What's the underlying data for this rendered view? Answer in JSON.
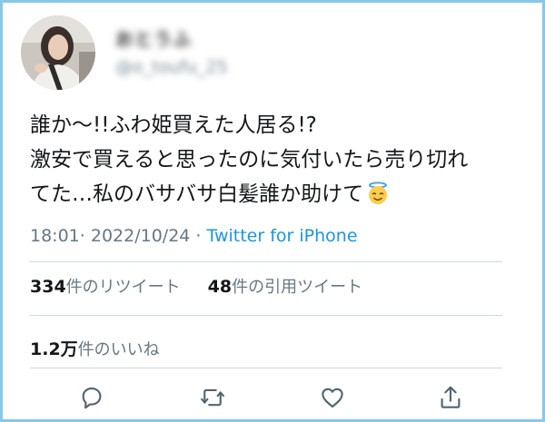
{
  "user": {
    "display_name": "おとうふ",
    "handle": "@o_toufu_25"
  },
  "tweet": {
    "lines": [
      "誰か〜!!ふわ姫買えた人居る!?",
      "激安で買えると思ったのに気付いたら売り切れ",
      "てた…私のバサバサ白髪誰か助けて"
    ],
    "emoji": "smiling-face-with-halo"
  },
  "meta": {
    "time": "18:01",
    "date": "2022/10/24",
    "source": "Twitter for iPhone"
  },
  "stats": {
    "retweets_count": "334",
    "retweets_label": "件のリツイート",
    "quotes_count": "48",
    "quotes_label": "件の引用ツイート",
    "likes_count": "1.2万",
    "likes_label": "件のいいね"
  },
  "actions": {
    "icons": [
      "reply-icon",
      "retweet-icon",
      "like-icon",
      "share-icon"
    ]
  },
  "colors": {
    "border": "#87c8e8",
    "link": "#1b95e0",
    "muted": "#657786",
    "icon": "#536471"
  }
}
